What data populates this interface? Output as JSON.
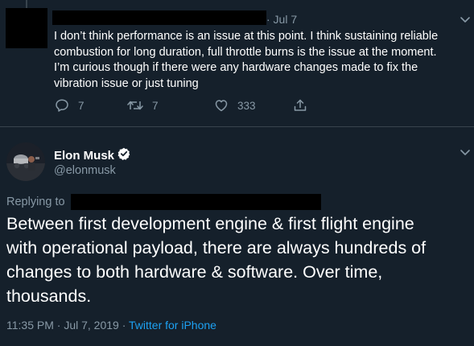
{
  "reply_tweet": {
    "date": "· Jul 7",
    "body_lines": [
      "I don’t think performance is an issue at this point. I think sustaining reliable",
      "combustion for long duration, full throttle burns is the issue at the moment.",
      "I’m curious though if there were any hardware changes made to fix the",
      "vibration issue or just tuning"
    ],
    "actions": {
      "reply_count": "7",
      "retweet_count": "7",
      "like_count": "333"
    }
  },
  "main_tweet": {
    "author_name": "Elon Musk",
    "author_handle": "@elonmusk",
    "replying_to_label": "Replying to",
    "body_lines": [
      "Between first development engine & first flight engine",
      "with operational payload, there are always hundreds of",
      "changes to both hardware & software. Over time,",
      "thousands."
    ],
    "timestamp": "11:35 PM · Jul 7, 2019 · ",
    "source": "Twitter for iPhone"
  },
  "colors": {
    "background": "#15202b",
    "secondary_text": "#8899a6",
    "link": "#1da1f2",
    "divider": "#38444d",
    "redaction": "#000000"
  },
  "icons": [
    "reply-icon",
    "retweet-icon",
    "like-icon",
    "share-icon",
    "chevron-down-icon",
    "verified-badge-icon"
  ]
}
